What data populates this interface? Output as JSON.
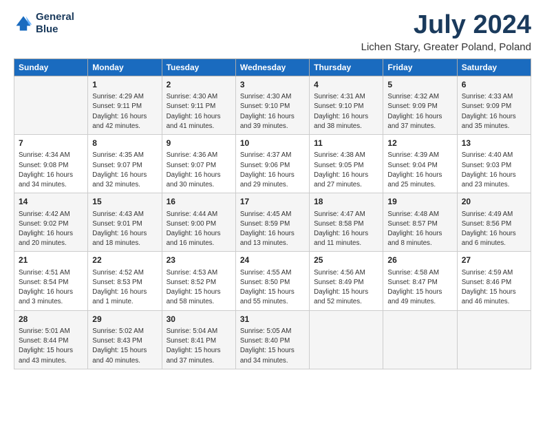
{
  "header": {
    "logo_line1": "General",
    "logo_line2": "Blue",
    "title": "July 2024",
    "subtitle": "Lichen Stary, Greater Poland, Poland"
  },
  "days_of_week": [
    "Sunday",
    "Monday",
    "Tuesday",
    "Wednesday",
    "Thursday",
    "Friday",
    "Saturday"
  ],
  "weeks": [
    [
      {
        "day": "",
        "info": ""
      },
      {
        "day": "1",
        "info": "Sunrise: 4:29 AM\nSunset: 9:11 PM\nDaylight: 16 hours\nand 42 minutes."
      },
      {
        "day": "2",
        "info": "Sunrise: 4:30 AM\nSunset: 9:11 PM\nDaylight: 16 hours\nand 41 minutes."
      },
      {
        "day": "3",
        "info": "Sunrise: 4:30 AM\nSunset: 9:10 PM\nDaylight: 16 hours\nand 39 minutes."
      },
      {
        "day": "4",
        "info": "Sunrise: 4:31 AM\nSunset: 9:10 PM\nDaylight: 16 hours\nand 38 minutes."
      },
      {
        "day": "5",
        "info": "Sunrise: 4:32 AM\nSunset: 9:09 PM\nDaylight: 16 hours\nand 37 minutes."
      },
      {
        "day": "6",
        "info": "Sunrise: 4:33 AM\nSunset: 9:09 PM\nDaylight: 16 hours\nand 35 minutes."
      }
    ],
    [
      {
        "day": "7",
        "info": "Sunrise: 4:34 AM\nSunset: 9:08 PM\nDaylight: 16 hours\nand 34 minutes."
      },
      {
        "day": "8",
        "info": "Sunrise: 4:35 AM\nSunset: 9:07 PM\nDaylight: 16 hours\nand 32 minutes."
      },
      {
        "day": "9",
        "info": "Sunrise: 4:36 AM\nSunset: 9:07 PM\nDaylight: 16 hours\nand 30 minutes."
      },
      {
        "day": "10",
        "info": "Sunrise: 4:37 AM\nSunset: 9:06 PM\nDaylight: 16 hours\nand 29 minutes."
      },
      {
        "day": "11",
        "info": "Sunrise: 4:38 AM\nSunset: 9:05 PM\nDaylight: 16 hours\nand 27 minutes."
      },
      {
        "day": "12",
        "info": "Sunrise: 4:39 AM\nSunset: 9:04 PM\nDaylight: 16 hours\nand 25 minutes."
      },
      {
        "day": "13",
        "info": "Sunrise: 4:40 AM\nSunset: 9:03 PM\nDaylight: 16 hours\nand 23 minutes."
      }
    ],
    [
      {
        "day": "14",
        "info": "Sunrise: 4:42 AM\nSunset: 9:02 PM\nDaylight: 16 hours\nand 20 minutes."
      },
      {
        "day": "15",
        "info": "Sunrise: 4:43 AM\nSunset: 9:01 PM\nDaylight: 16 hours\nand 18 minutes."
      },
      {
        "day": "16",
        "info": "Sunrise: 4:44 AM\nSunset: 9:00 PM\nDaylight: 16 hours\nand 16 minutes."
      },
      {
        "day": "17",
        "info": "Sunrise: 4:45 AM\nSunset: 8:59 PM\nDaylight: 16 hours\nand 13 minutes."
      },
      {
        "day": "18",
        "info": "Sunrise: 4:47 AM\nSunset: 8:58 PM\nDaylight: 16 hours\nand 11 minutes."
      },
      {
        "day": "19",
        "info": "Sunrise: 4:48 AM\nSunset: 8:57 PM\nDaylight: 16 hours\nand 8 minutes."
      },
      {
        "day": "20",
        "info": "Sunrise: 4:49 AM\nSunset: 8:56 PM\nDaylight: 16 hours\nand 6 minutes."
      }
    ],
    [
      {
        "day": "21",
        "info": "Sunrise: 4:51 AM\nSunset: 8:54 PM\nDaylight: 16 hours\nand 3 minutes."
      },
      {
        "day": "22",
        "info": "Sunrise: 4:52 AM\nSunset: 8:53 PM\nDaylight: 16 hours\nand 1 minute."
      },
      {
        "day": "23",
        "info": "Sunrise: 4:53 AM\nSunset: 8:52 PM\nDaylight: 15 hours\nand 58 minutes."
      },
      {
        "day": "24",
        "info": "Sunrise: 4:55 AM\nSunset: 8:50 PM\nDaylight: 15 hours\nand 55 minutes."
      },
      {
        "day": "25",
        "info": "Sunrise: 4:56 AM\nSunset: 8:49 PM\nDaylight: 15 hours\nand 52 minutes."
      },
      {
        "day": "26",
        "info": "Sunrise: 4:58 AM\nSunset: 8:47 PM\nDaylight: 15 hours\nand 49 minutes."
      },
      {
        "day": "27",
        "info": "Sunrise: 4:59 AM\nSunset: 8:46 PM\nDaylight: 15 hours\nand 46 minutes."
      }
    ],
    [
      {
        "day": "28",
        "info": "Sunrise: 5:01 AM\nSunset: 8:44 PM\nDaylight: 15 hours\nand 43 minutes."
      },
      {
        "day": "29",
        "info": "Sunrise: 5:02 AM\nSunset: 8:43 PM\nDaylight: 15 hours\nand 40 minutes."
      },
      {
        "day": "30",
        "info": "Sunrise: 5:04 AM\nSunset: 8:41 PM\nDaylight: 15 hours\nand 37 minutes."
      },
      {
        "day": "31",
        "info": "Sunrise: 5:05 AM\nSunset: 8:40 PM\nDaylight: 15 hours\nand 34 minutes."
      },
      {
        "day": "",
        "info": ""
      },
      {
        "day": "",
        "info": ""
      },
      {
        "day": "",
        "info": ""
      }
    ]
  ]
}
